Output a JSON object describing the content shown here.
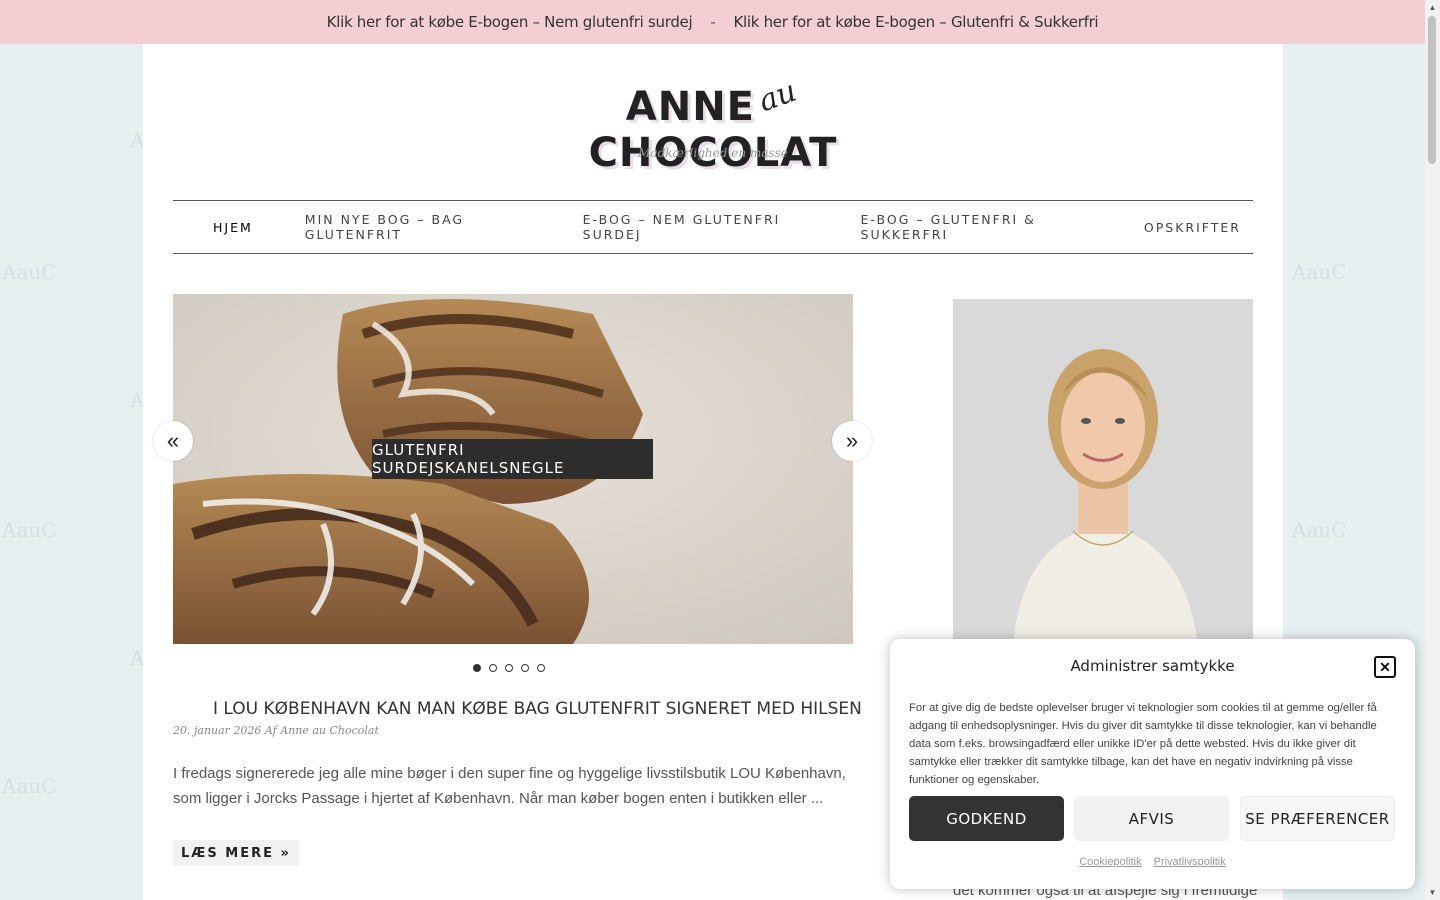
{
  "topbar": {
    "link1": "Klik her for at købe E-bogen – Nem glutenfri surdej",
    "separator": "-",
    "link2": "Klik her for at købe E-bogen – Glutenfri & Sukkerfri"
  },
  "brand": {
    "logo_word1": "ANNE",
    "logo_au": "au",
    "logo_word2": "CHOCOLAT",
    "tagline": "Madkærlighed en masse",
    "watermark": "AauC"
  },
  "nav": {
    "items": [
      {
        "label": "HJEM"
      },
      {
        "label": "MIN NYE BOG – BAG GLUTENFRIT"
      },
      {
        "label": "E-BOG – NEM GLUTENFRI SURDEJ"
      },
      {
        "label": "E-BOG – GLUTENFRI & SUKKERFRI"
      },
      {
        "label": "OPSKRIFTER"
      }
    ]
  },
  "slider": {
    "caption": "GLUTENFRI SURDEJSKANELSNEGLE",
    "prev": "«",
    "next": "»",
    "slide_count": 5,
    "active_slide": 1
  },
  "post": {
    "title": "I LOU KØBENHAVN KAN MAN KØBE BAG GLUTENFRIT SIGNERET MED HILSEN",
    "meta": "20. januar 2026 Af Anne au Chocolat",
    "excerpt": "I fredags signererede jeg alle mine bøger i den super fine og hyggelige livsstilsbutik LOU København, som ligger i Jorcks Passage i hjertet af København. Når man køber bogen enten i butikken eller ...",
    "read_more": "LÆS MERE »"
  },
  "sidebar": {
    "peek_text": "det kommer også til at afspejle sig i fremtidige"
  },
  "consent": {
    "title": "Administrer samtykke",
    "close": "✕",
    "text": "For at give dig de bedste oplevelser bruger vi teknologier som cookies til at gemme og/eller få adgang til enhedsoplysninger. Hvis du giver dit samtykke til disse teknologier, kan vi behandle data som f.eks. browsingadfærd eller unikke ID'er på dette websted. Hvis du ikke giver dit samtykke eller trækker dit samtykke tilbage, kan det have en negativ indvirkning på visse funktioner og egenskaber.",
    "accept": "GODKEND",
    "deny": "AFVIS",
    "prefs": "SE PRÆFERENCER",
    "link_cookie": "Cookiepolitik",
    "link_privacy": "Privatlivspolitik"
  }
}
